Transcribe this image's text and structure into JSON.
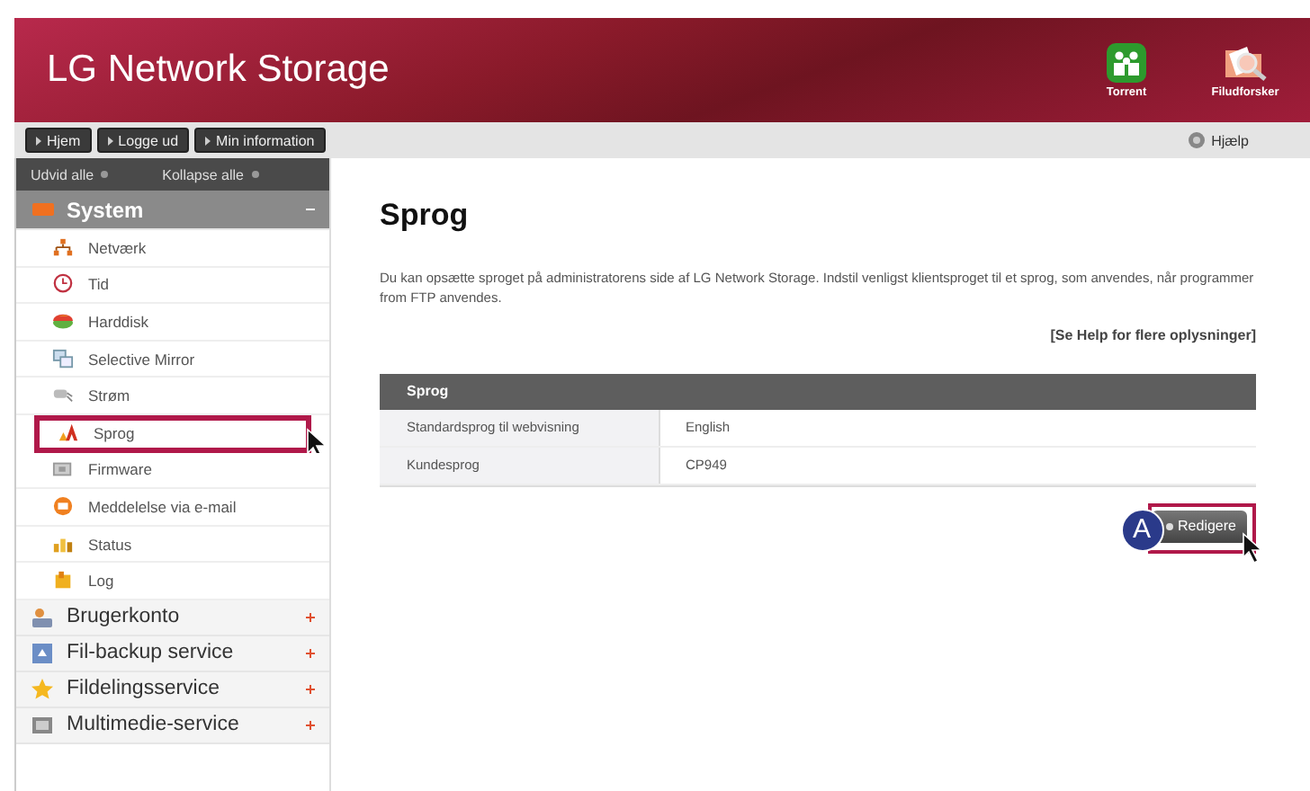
{
  "header": {
    "title": "LG Network Storage",
    "shortcuts": [
      {
        "label": "Torrent",
        "kind": "torrent"
      },
      {
        "label": "Filudforsker",
        "kind": "explorer"
      }
    ]
  },
  "nav": {
    "buttons": [
      "Hjem",
      "Logge ud",
      "Min information"
    ],
    "help": "Hjælp"
  },
  "sidebar": {
    "controls": [
      "Udvid alle",
      "Kollapse alle"
    ],
    "sections": [
      {
        "label": "System",
        "expanded": true,
        "children": [
          {
            "label": "Netværk",
            "selected": false
          },
          {
            "label": "Tid",
            "selected": false
          },
          {
            "label": "Harddisk",
            "selected": false
          },
          {
            "label": "Selective Mirror",
            "selected": false
          },
          {
            "label": "Strøm",
            "selected": false
          },
          {
            "label": "Sprog",
            "selected": true
          },
          {
            "label": "Firmware",
            "selected": false
          },
          {
            "label": "Meddelelse via e-mail",
            "selected": false
          },
          {
            "label": "Status",
            "selected": false
          },
          {
            "label": "Log",
            "selected": false
          }
        ]
      },
      {
        "label": "Brugerkonto",
        "expanded": false
      },
      {
        "label": "Fil-backup service",
        "expanded": false
      },
      {
        "label": "Fildelingsservice",
        "expanded": false
      },
      {
        "label": "Multimedie-service",
        "expanded": false
      }
    ]
  },
  "content": {
    "title": "Sprog",
    "description": "Du kan opsætte sproget på administratorens side af LG Network Storage. Indstil venligst klientsproget til et sprog, som anvendes, når programmer from FTP anvendes.",
    "help_link": "[Se Help for flere oplysninger]",
    "table": {
      "title": "Sprog",
      "rows": [
        {
          "label": "Standardsprog til webvisning",
          "value": "English"
        },
        {
          "label": "Kundesprog",
          "value": "CP949"
        }
      ]
    },
    "button": {
      "label": "Redigere",
      "callout": "A",
      "highlighted": true
    }
  }
}
